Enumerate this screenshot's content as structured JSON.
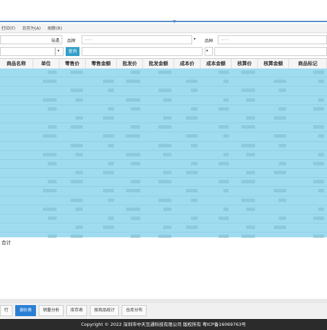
{
  "toolbar": {
    "print_label": "打印(F)",
    "save_as_label": "另存为(A)",
    "refresh_label": "刷新(R)"
  },
  "filters": {
    "category_label": "导出",
    "brand_label": "品牌",
    "brand_placeholder": "——",
    "origin_label": "品种",
    "origin_placeholder": "——",
    "query_button": "查询"
  },
  "table": {
    "columns": [
      "商品名称",
      "单位",
      "零售价",
      "零售金额",
      "批发价",
      "批发金额",
      "成本价",
      "成本金额",
      "核算价",
      "核算金额",
      "商品标记"
    ],
    "row_count": 20,
    "total_label": "合计"
  },
  "tabs": [
    "行",
    "调价表",
    "销量分析",
    "库存表",
    "按商品统计",
    "仓库分布"
  ],
  "footer": {
    "copyright": "Copyright © 2022 深圳市中天互通科技有限公司 版权所有 粤ICP备16069763号"
  }
}
